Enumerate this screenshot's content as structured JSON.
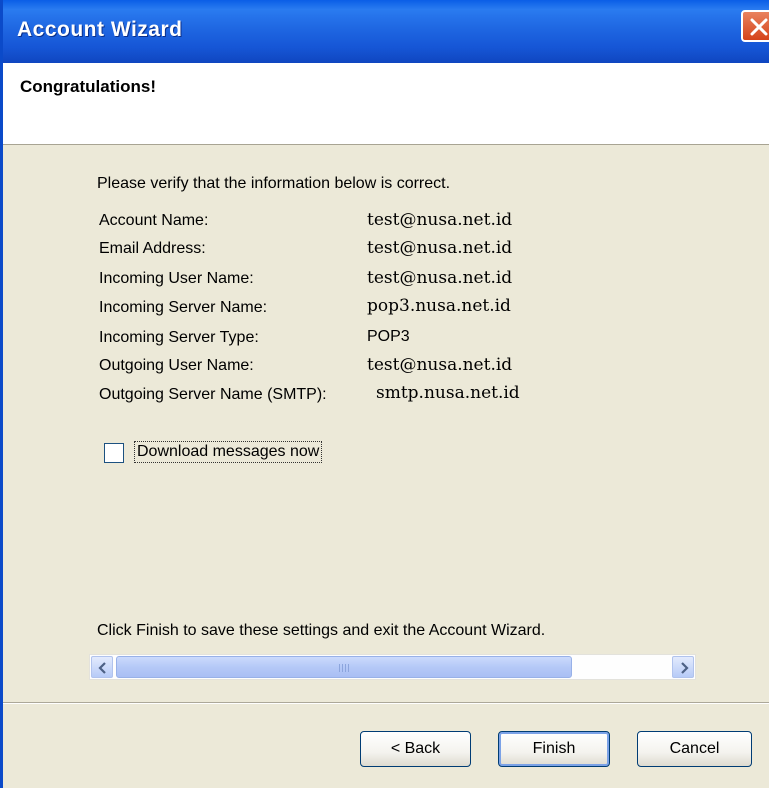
{
  "window": {
    "title": "Account Wizard",
    "close_icon": "close-icon"
  },
  "header": {
    "title": "Congratulations!"
  },
  "content": {
    "intro": "Please verify that the information below is correct.",
    "fields": [
      {
        "label": "Account Name:",
        "value": "test@nusa.net.id"
      },
      {
        "label": "Email Address:",
        "value": "test@nusa.net.id"
      },
      {
        "label": "Incoming User Name:",
        "value": "test@nusa.net.id"
      },
      {
        "label": "Incoming Server Name:",
        "value": "pop3.nusa.net.id"
      },
      {
        "label": "Incoming Server Type:",
        "value": "POP3"
      },
      {
        "label": "Outgoing User Name:",
        "value": "test@nusa.net.id"
      },
      {
        "label": "Outgoing Server Name (SMTP):",
        "value": "smtp.nusa.net.id"
      }
    ],
    "download_checkbox": {
      "label": "Download messages now",
      "checked": false
    },
    "finish_note": "Click Finish to save these settings and exit the Account Wizard."
  },
  "scrollbar": {
    "left_arrow_icon": "chevron-left-icon",
    "right_arrow_icon": "chevron-right-icon"
  },
  "buttons": {
    "back": "< Back",
    "finish": "Finish",
    "cancel": "Cancel"
  },
  "colors": {
    "titlebar": "#1f67e2",
    "close": "#d5431a",
    "dialog_bg": "#ece9d8"
  }
}
